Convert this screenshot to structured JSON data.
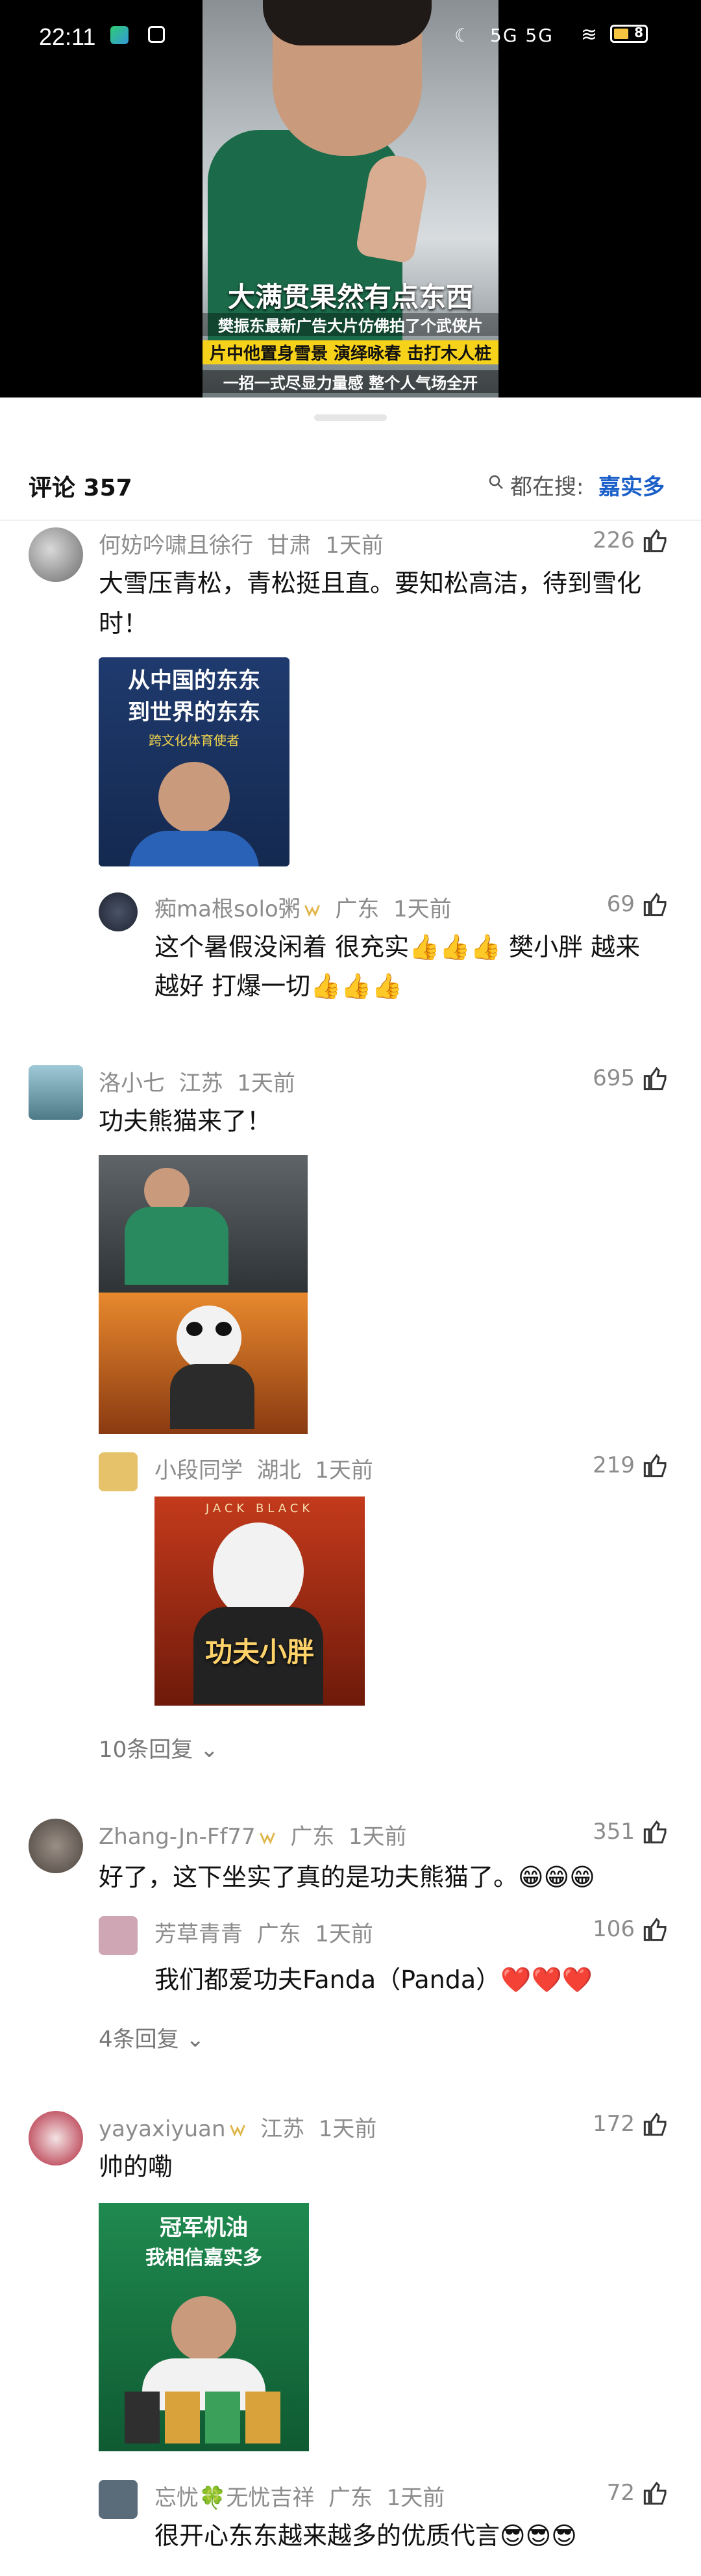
{
  "status_bar": {
    "time": "22:11",
    "network": "5G 5G",
    "battery": "8"
  },
  "video": {
    "caption_main": "大满贯果然有点东西",
    "caption_lines": [
      "樊振东最新广告大片仿佛拍了个武侠片",
      "片中他置身雪景 演绎咏春 击打木人桩",
      "一招一式尽显力量感 整个人气场全开"
    ]
  },
  "comments_header": {
    "title": "评论 357",
    "search_prefix": "都在搜:",
    "search_term": "嘉实多"
  },
  "comments": [
    {
      "user": "何妨吟啸且徐行",
      "location": "甘肃",
      "time": "1天前",
      "likes": "226",
      "text_line1": "大雪压青松，青松挺且直。要知松高洁，待到雪化",
      "text_line2": "时！",
      "image_text": [
        "从中国的东东",
        "到世界的东东",
        "跨文化体育使者"
      ],
      "reply": {
        "user": "痴ma根solo粥",
        "location": "广东",
        "time": "1天前",
        "likes": "69",
        "line1": "这个暑假没闲着 很充实👍👍👍 樊小胖 越来",
        "line2": "越好 打爆一切👍👍👍"
      }
    },
    {
      "user": "洛小七",
      "location": "江苏",
      "time": "1天前",
      "likes": "695",
      "text_line1": "功夫熊猫来了！",
      "reply": {
        "user": "小段同学",
        "location": "湖北",
        "time": "1天前",
        "likes": "219",
        "image_caption": "功夫小胖",
        "image_header": "JACK BLACK"
      },
      "more_replies": "10条回复"
    },
    {
      "user": "Zhang-Jn-Ff77",
      "location": "广东",
      "time": "1天前",
      "likes": "351",
      "text_line1": "好了，这下坐实了真的是功夫熊猫了。😁😁😁",
      "reply": {
        "user": "芳草青青",
        "location": "广东",
        "time": "1天前",
        "likes": "106",
        "line1": "我们都爱功夫Fanda（Panda）❤️❤️❤️"
      },
      "more_replies": "4条回复"
    },
    {
      "user": "yayaxiyuan",
      "location": "江苏",
      "time": "1天前",
      "likes": "172",
      "text_line1": "帅的嘞",
      "image_text": [
        "冠军机油",
        "我相信嘉实多"
      ],
      "reply": {
        "user": "忘忧🍀无忧吉祥",
        "location": "广东",
        "time": "1天前",
        "likes": "72",
        "line1": "很开心东东越来越多的优质代言😎😎😎"
      }
    }
  ],
  "colors": {
    "link": "#1a5ec8",
    "meta": "#8c8c8c",
    "badge": "#e0b64a"
  }
}
